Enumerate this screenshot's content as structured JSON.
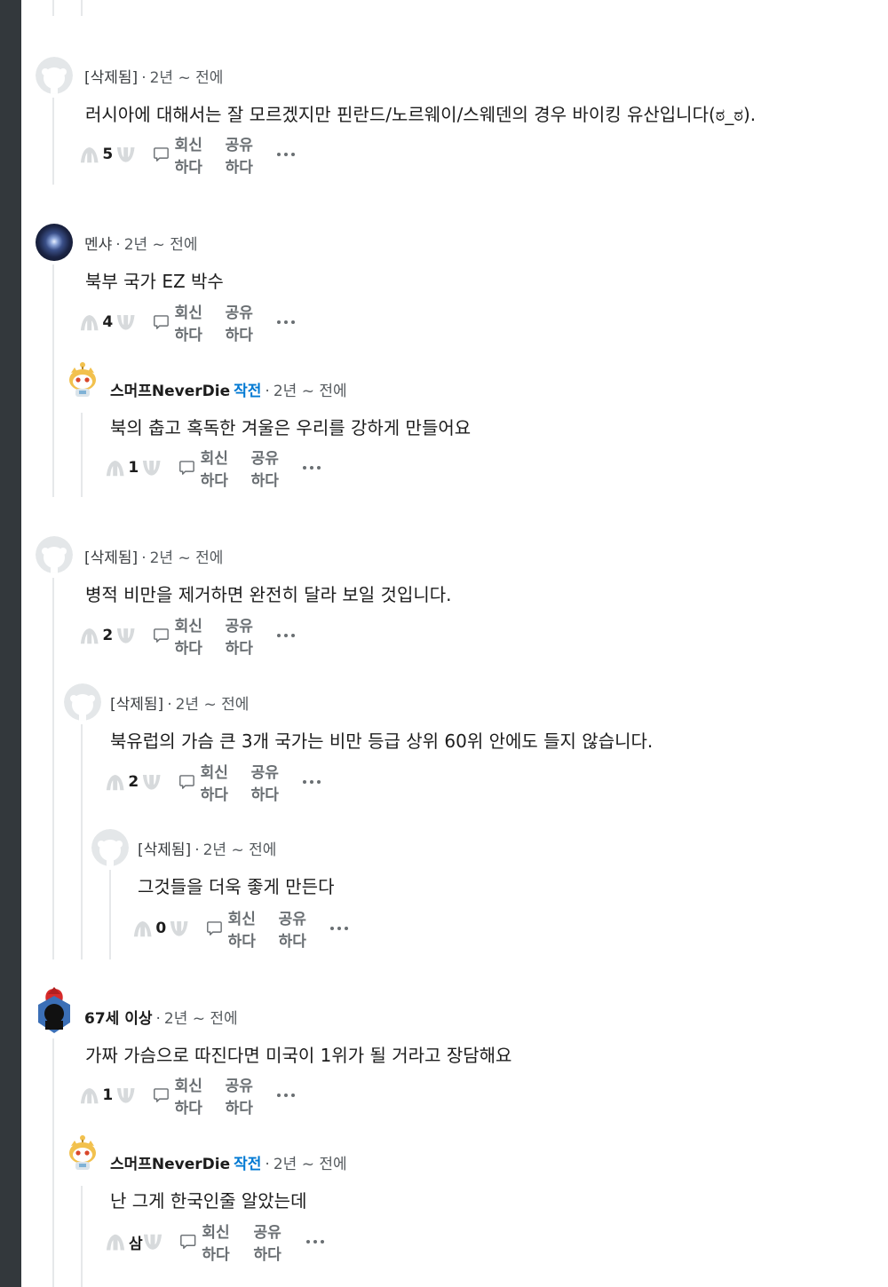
{
  "comments": [
    {
      "author": "[삭제됨]",
      "time": "2년 ~ 전에",
      "body": "러시아에 대해서는 잘 모르겠지만 핀란드/노르웨이/스웨덴의 경우 바이킹 유산입니다(ಠ_ಠ).",
      "votes": "5",
      "avatar": "deleted-avatar"
    },
    {
      "author": "멘샤",
      "time": "2년 ~ 전에",
      "body": "북부 국가 EZ 박수",
      "votes": "4",
      "avatar": "galaxy-avatar"
    },
    {
      "author": "스머프NeverDie",
      "op_label": "작전",
      "time": "2년 ~ 전에",
      "body": "북의 춥고 혹독한 겨울은 우리를 강하게 만들어요",
      "votes": "1",
      "avatar": "snoo-cat-avatar"
    },
    {
      "author": "[삭제됨]",
      "time": "2년 ~ 전에",
      "body": "병적 비만을 제거하면 완전히 달라 보일 것입니다.",
      "votes": "2",
      "avatar": "deleted-avatar"
    },
    {
      "author": "[삭제됨]",
      "time": "2년 ~ 전에",
      "body": "북유럽의 가슴 큰 3개 국가는 비만 등급 상위 60위 안에도 들지 않습니다.",
      "votes": "2",
      "avatar": "deleted-avatar"
    },
    {
      "author": "[삭제됨]",
      "time": "2년 ~ 전에",
      "body": "그것들을 더욱 좋게 만든다",
      "votes": "0",
      "avatar": "deleted-avatar"
    },
    {
      "author": "67세 이상",
      "time": "2년 ~ 전에",
      "body": "가짜 가슴으로 따진다면 미국이 1위가 될 거라고 장담해요",
      "votes": "1",
      "avatar": "spartan-avatar"
    },
    {
      "author": "스머프NeverDie",
      "op_label": "작전",
      "time": "2년 ~ 전에",
      "body": "난 그게 한국인줄 알았는데",
      "votes": "삼",
      "avatar": "snoo-cat-avatar"
    }
  ],
  "actions": {
    "reply": "회신하다",
    "share": "공유하다"
  },
  "separator": "·",
  "colors": {
    "op_blue": "#0079d3",
    "sidebar": "#33383c",
    "thread_line": "#e6e8ea"
  }
}
